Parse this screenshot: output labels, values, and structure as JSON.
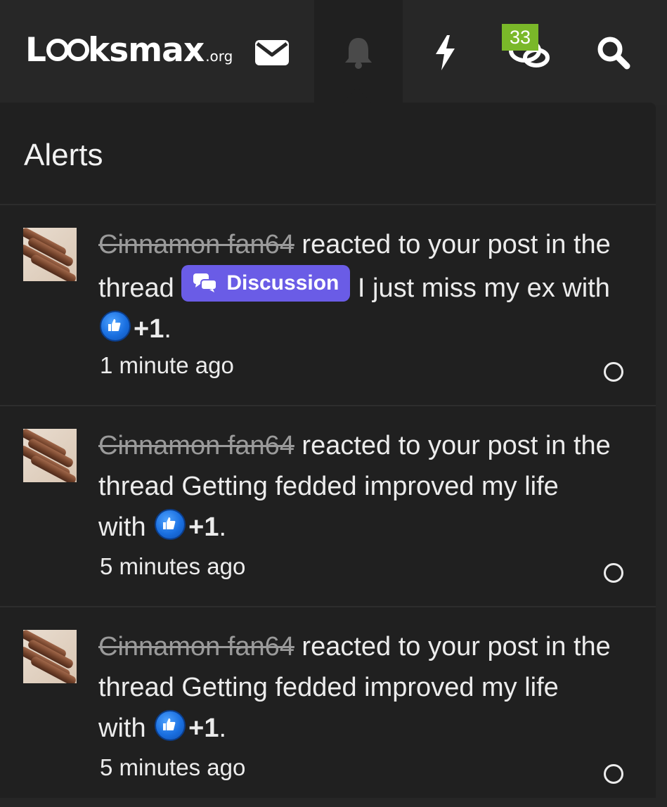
{
  "header": {
    "logo_text": "Looksmax",
    "logo_main_prefix": "L",
    "logo_main_suffix": "ksmax",
    "logo_tld": ".org",
    "icons": [
      "mail-icon",
      "bell-icon",
      "lightning-icon",
      "chat-icon",
      "search-icon"
    ],
    "chat_badge": "33",
    "badge_color": "#7ab829"
  },
  "panel": {
    "title": "Alerts",
    "alerts": [
      {
        "user": "Cinnamon fan64",
        "action": " reacted to your post in the thread ",
        "prefix": "Discussion",
        "thread": " I just miss my ex",
        "with": " with ",
        "reaction": "+1",
        "period": ".",
        "time": "1 minute ago"
      },
      {
        "user": "Cinnamon fan64",
        "action": " reacted to your post in the thread ",
        "thread": "Getting fedded improved my life",
        "with": " with ",
        "reaction": "+1",
        "period": ".",
        "time": "5 minutes ago"
      },
      {
        "user": "Cinnamon fan64",
        "action": " reacted to your post in the thread ",
        "thread": "Getting fedded improved my life",
        "with": " with ",
        "reaction": "+1",
        "period": ".",
        "time": "5 minutes ago"
      }
    ]
  },
  "colors": {
    "prefix_bg": "#6a5ce6",
    "reaction_blue": "#1a6fe0",
    "panel_bg": "#202020"
  }
}
